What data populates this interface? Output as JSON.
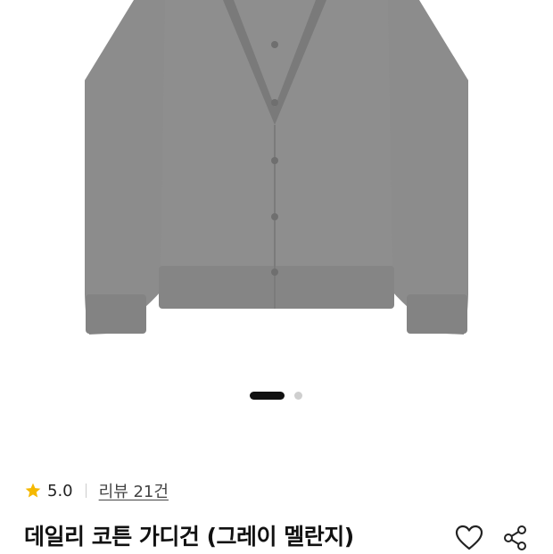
{
  "product": {
    "image_description_icon": "gray-cardigan-image",
    "carousel": {
      "total": 2,
      "active": 1
    },
    "rating": {
      "value": "5.0",
      "icon": "star-icon",
      "color": "#f5b800"
    },
    "reviews_label": "리뷰 21건",
    "title": "데일리 코튼 가디건 (그레이 멜란지)",
    "actions": {
      "wishlist_icon": "heart-icon",
      "share_icon": "share-icon"
    }
  }
}
